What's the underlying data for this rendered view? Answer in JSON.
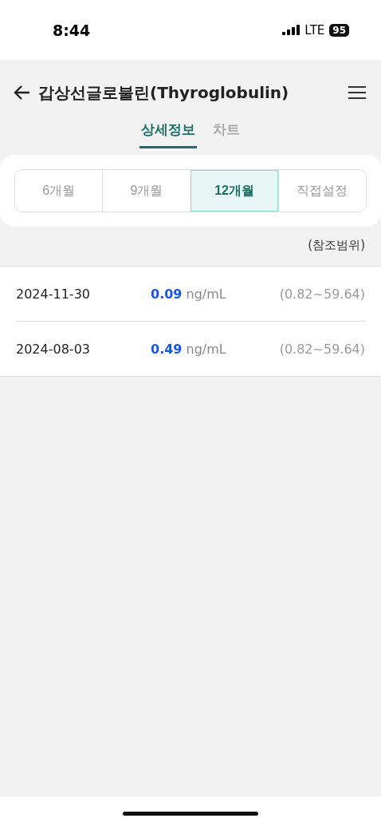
{
  "status_bar": {
    "time": "8:44",
    "network": "LTE",
    "battery": "95"
  },
  "header": {
    "title": "갑상선글로불린(Thyroglobulin)"
  },
  "tabs": [
    {
      "label": "상세정보",
      "selected": true
    },
    {
      "label": "차트",
      "selected": false
    }
  ],
  "periods": [
    {
      "label": "6개월",
      "selected": false
    },
    {
      "label": "9개월",
      "selected": false
    },
    {
      "label": "12개월",
      "selected": true
    },
    {
      "label": "직접설정",
      "selected": false
    }
  ],
  "reference_header": "(참조범위)",
  "results": [
    {
      "date": "2024-11-30",
      "value": "0.09",
      "unit": "ng/mL",
      "range": "(0.82~59.64)"
    },
    {
      "date": "2024-08-03",
      "value": "0.49",
      "unit": "ng/mL",
      "range": "(0.82~59.64)"
    }
  ]
}
